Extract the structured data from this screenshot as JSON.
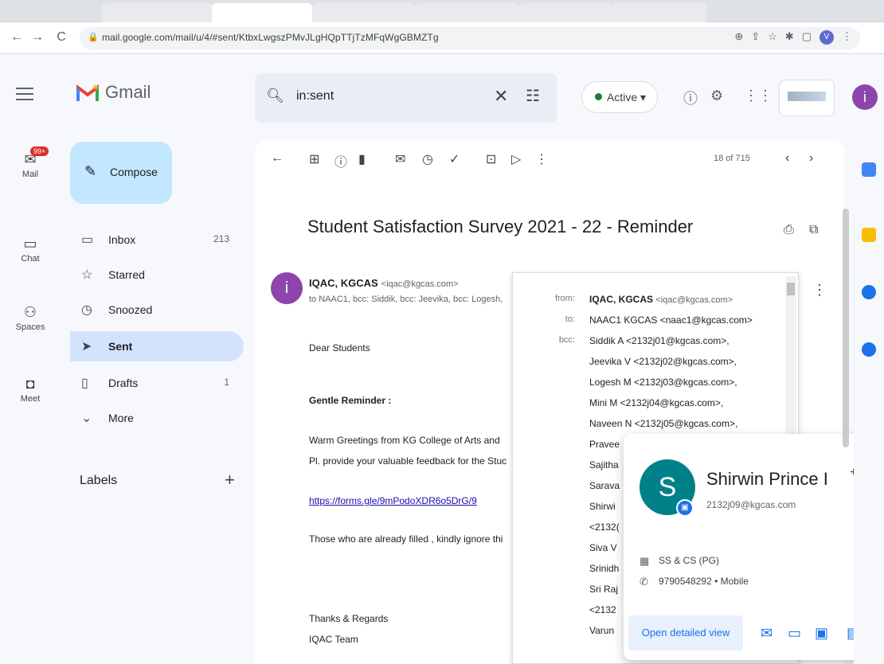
{
  "browser": {
    "url": "mail.google.com/mail/u/4/#sent/KtbxLwgszPMvJLgHQpTTjTzMFqWgGBMZTg"
  },
  "gmail": {
    "logo_text": "Gmail",
    "search_query": "in:sent",
    "status": "Active",
    "account_initial": "i"
  },
  "rail": [
    {
      "label": "Mail",
      "badge": "99+"
    },
    {
      "label": "Chat"
    },
    {
      "label": "Spaces"
    },
    {
      "label": "Meet"
    }
  ],
  "sidebar": {
    "compose": "Compose",
    "items": [
      {
        "label": "Inbox",
        "count": "213"
      },
      {
        "label": "Starred",
        "count": ""
      },
      {
        "label": "Snoozed",
        "count": ""
      },
      {
        "label": "Sent",
        "count": ""
      },
      {
        "label": "Drafts",
        "count": "1"
      },
      {
        "label": "More",
        "count": ""
      }
    ],
    "labels_title": "Labels"
  },
  "toolbar": {
    "pager": "18 of 715"
  },
  "email": {
    "subject": "Student Satisfaction Survey 2021 - 22 - Reminder",
    "sender_name": "IQAC, KGCAS",
    "sender_email": "<iqac@kgcas.com>",
    "recipients": "to NAAC1, bcc: Siddik, bcc: Jeevika, bcc: Logesh,",
    "greeting": "Dear Students",
    "heading": "Gentle Reminder :",
    "line1": "Warm Greetings from KG College  of Arts and",
    "line2": "Pl. provide your valuable feedback for the Stuc",
    "link": "https://forms.gle/9mPodoXDR6o5DrG/9",
    "line3": "Those who are already filled , kindly ignore thi",
    "sign1": "Thanks & Regards",
    "sign2": "IQAC Team"
  },
  "recipients_popup": {
    "from_key": "from:",
    "from_name": "IQAC, KGCAS",
    "from_email": "<iqac@kgcas.com>",
    "to_key": "to:",
    "to_value": "NAAC1 KGCAS <naac1@kgcas.com>",
    "bcc_key": "bcc:",
    "bcc": [
      "Siddik A <2132j01@kgcas.com>,",
      "Jeevika V <2132j02@kgcas.com>,",
      "Logesh M <2132j03@kgcas.com>,",
      "Mini M <2132j04@kgcas.com>,",
      "Naveen N <2132j05@kgcas.com>,",
      "Pravee",
      "Sajitha",
      "Sarava",
      "Shirwi",
      "<2132(",
      "Siva V",
      "Srinidh",
      "Sri Raj",
      "<2132",
      "Varun"
    ]
  },
  "contact_card": {
    "initial": "S",
    "name": "Shirwin Prince I",
    "email": "2132j09@kgcas.com",
    "department": "SS & CS (PG)",
    "phone": "9790548292 • Mobile",
    "open_button": "Open detailed view"
  }
}
